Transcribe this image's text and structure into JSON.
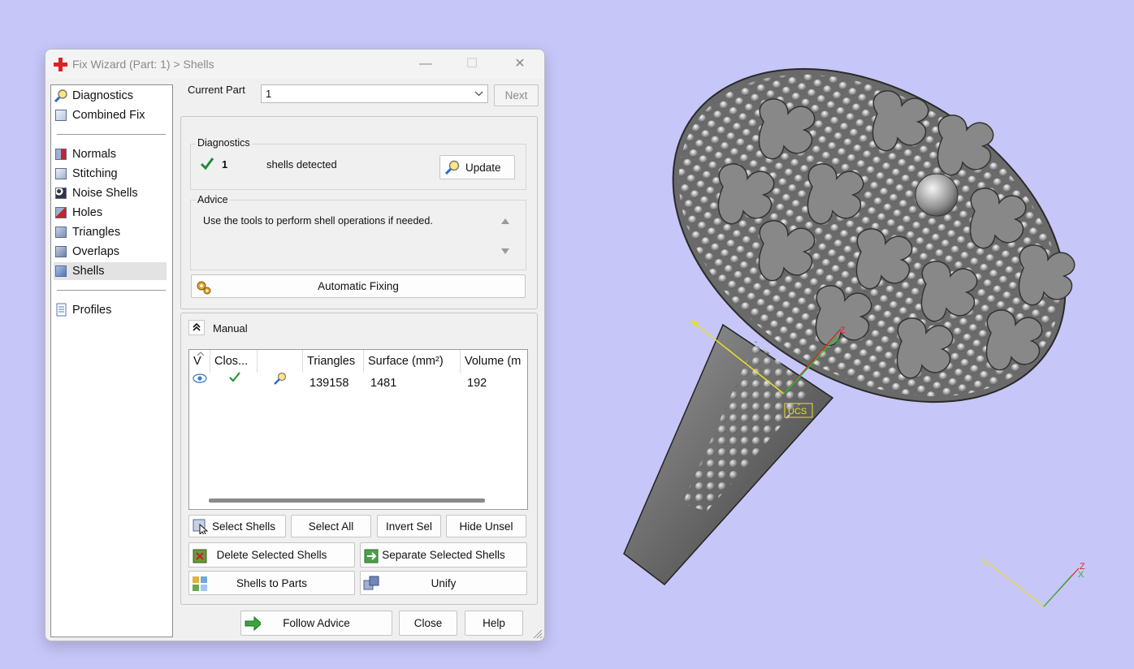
{
  "window": {
    "title": "Fix Wizard (Part: 1) > Shells",
    "controls": {
      "minimize": "—",
      "maximize": "☐",
      "close": "✕"
    }
  },
  "nav": {
    "group1": [
      {
        "label": "Diagnostics",
        "icon": "magnifier-icon"
      },
      {
        "label": "Combined Fix",
        "icon": "cube-icon"
      }
    ],
    "group2": [
      {
        "label": "Normals",
        "icon": "normals-cube-icon"
      },
      {
        "label": "Stitching",
        "icon": "stitching-cube-icon"
      },
      {
        "label": "Noise Shells",
        "icon": "noise-shells-cube-icon"
      },
      {
        "label": "Holes",
        "icon": "holes-cube-icon"
      },
      {
        "label": "Triangles",
        "icon": "triangles-cube-icon"
      },
      {
        "label": "Overlaps",
        "icon": "overlaps-cube-icon"
      },
      {
        "label": "Shells",
        "icon": "shells-cube-icon",
        "selected": true
      }
    ],
    "group3": [
      {
        "label": "Profiles",
        "icon": "document-icon"
      }
    ]
  },
  "current_part": {
    "label": "Current Part",
    "value": "1",
    "next_button": "Next"
  },
  "diagnostics": {
    "legend": "Diagnostics",
    "count": "1",
    "text": "shells detected",
    "update_button": "Update"
  },
  "advice": {
    "legend": "Advice",
    "text": "Use the tools to perform shell operations if needed."
  },
  "automatic_fixing_button": "Automatic Fixing",
  "manual": {
    "label": "Manual",
    "table": {
      "columns": [
        "V",
        "Clos...",
        "",
        "Triangles",
        "Surface (mm²)",
        "Volume (m"
      ],
      "rows": [
        {
          "visible_icon": "eye-icon",
          "closed_icon": "checkmark-icon",
          "zoom_icon": "magnifier-icon",
          "triangles": "139158",
          "surface": "1481",
          "volume": "192"
        }
      ]
    },
    "buttons": {
      "select_shells": "Select Shells",
      "select_all": "Select All",
      "invert_sel": "Invert Sel",
      "hide_unsel": "Hide Unsel",
      "delete_selected_shells": "Delete Selected Shells",
      "separate_selected_shells": "Separate Selected Shells",
      "shells_to_parts": "Shells to Parts",
      "unify": "Unify"
    }
  },
  "footer": {
    "follow_advice": "Follow Advice",
    "close": "Close",
    "help": "Help"
  },
  "viewport": {
    "ucs_label": "UCS",
    "axes": {
      "x": "X",
      "y": "Y",
      "z": "Z"
    },
    "background_color": "#c6c6f8"
  }
}
